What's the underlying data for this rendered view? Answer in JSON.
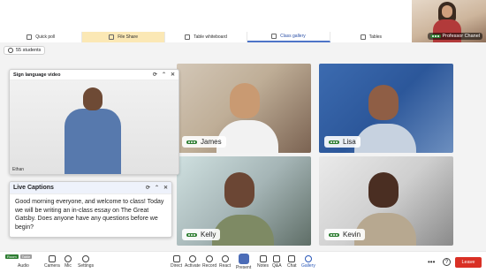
{
  "tabs": [
    {
      "label": "Quick poll",
      "icon": "poll-icon"
    },
    {
      "label": "File Share",
      "icon": "file-share-icon"
    },
    {
      "label": "Table whiteboard",
      "icon": "whiteboard-icon"
    },
    {
      "label": "Class gallery",
      "icon": "gallery-icon"
    },
    {
      "label": "Tables",
      "icon": "tables-icon"
    }
  ],
  "presenter": {
    "name": "Professor Chanel"
  },
  "students": {
    "count_label": "55 students"
  },
  "sign_panel": {
    "title": "Sign language video",
    "interpreter": "Ethan"
  },
  "captions": {
    "title": "Live Captions",
    "text": "Good morning everyone, and welcome to class! Today we will be writing an in-class essay on The Great Gatsby. Does anyone have any questions before we begin?"
  },
  "tiles": [
    {
      "name": "James"
    },
    {
      "name": "Lisa"
    },
    {
      "name": "Kelly"
    },
    {
      "name": "Kevin"
    }
  ],
  "controls": {
    "badge_room": "Room",
    "badge_table": "Table",
    "audio": "Audio",
    "camera": "Camera",
    "mic": "Mic",
    "settings": "Settings",
    "direct": "Direct",
    "activate": "Activate",
    "record": "Record",
    "react": "React",
    "present": "Present",
    "notes": "Notes",
    "qa": "Q&A",
    "chat": "Chat",
    "gallery": "Gallery",
    "more": "•••",
    "help": "?",
    "leave": "Leave"
  },
  "colors": {
    "accent": "#4b6cb7",
    "leave": "#d93025",
    "active_tab": "#fbe8b5"
  }
}
